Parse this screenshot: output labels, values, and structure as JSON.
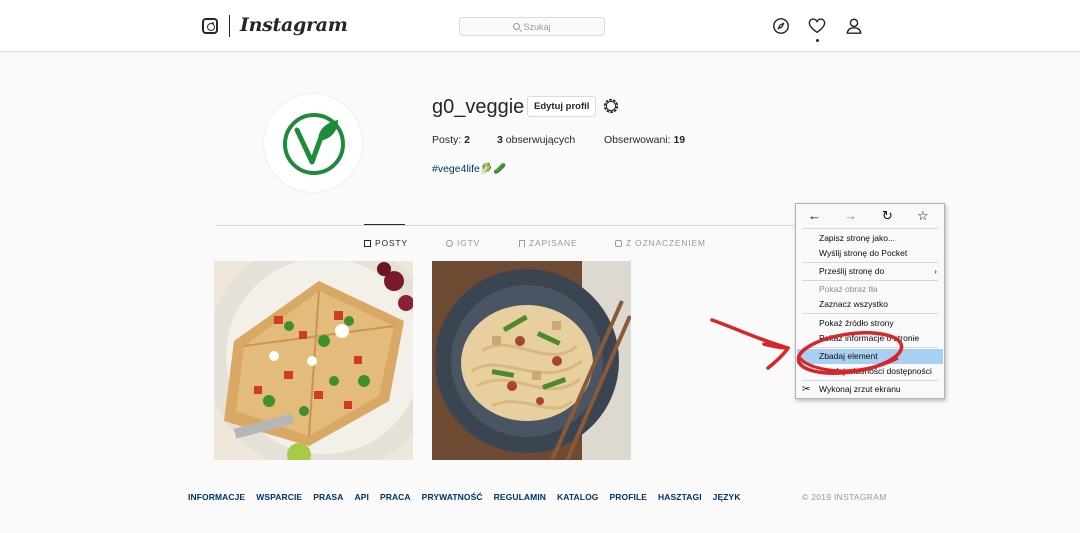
{
  "topbar": {
    "logo_text": "Instagram",
    "search_placeholder": "Szukaj",
    "icons": [
      "compass-icon",
      "heart-icon",
      "user-icon"
    ]
  },
  "profile": {
    "username": "g0_veggie",
    "edit_button": "Edytuj profil",
    "stats": {
      "posts_label": "Posty:",
      "posts_count": "2",
      "followers_count": "3",
      "followers_label": "obserwujących",
      "following_label": "Obserwowani:",
      "following_count": "19"
    },
    "bio": "#vege4life🥬🥒"
  },
  "tabs": [
    {
      "label": "POSTY",
      "icon": "grid-icon",
      "active": true
    },
    {
      "label": "IGTV",
      "icon": "igtv-icon",
      "active": false
    },
    {
      "label": "ZAPISANE",
      "icon": "bookmark-icon",
      "active": false
    },
    {
      "label": "Z OZNACZENIEM",
      "icon": "tag-icon",
      "active": false
    }
  ],
  "footer": {
    "links": [
      "INFORMACJE",
      "WSPARCIE",
      "PRASA",
      "API",
      "PRACA",
      "PRYWATNOŚĆ",
      "REGULAMIN",
      "KATALOG",
      "PROFILE",
      "HASZTAGI",
      "JĘZYK"
    ],
    "copyright": "© 2019 INSTAGRAM"
  },
  "context_menu": {
    "nav_icons": [
      "back-arrow-icon",
      "forward-arrow-icon",
      "reload-icon",
      "bookmark-star-icon"
    ],
    "items": [
      {
        "label": "Zapisz stronę jako...",
        "disabled": false
      },
      {
        "label": "Wyślij stronę do Pocket",
        "disabled": false
      },
      {
        "label": "Prześlij stronę do",
        "disabled": false,
        "submenu": true
      },
      {
        "label": "Pokaż obraz tła",
        "disabled": true
      },
      {
        "label": "Zaznacz wszystko",
        "disabled": false
      },
      {
        "label": "Pokaż źródło strony",
        "disabled": false
      },
      {
        "label": "Pokaż informacje o stronie",
        "disabled": false
      },
      {
        "label": "Zbadaj element",
        "disabled": false,
        "highlighted": true
      },
      {
        "label": "Zbadaj własności dostępności",
        "disabled": false
      },
      {
        "label": "Wykonaj zrzut ekranu",
        "disabled": false
      }
    ]
  },
  "colors": {
    "accent_link": "#003569",
    "menu_highlight": "#a8d0f3",
    "annotation": "#d7262b",
    "vegan_logo_green": "#1e8a3c"
  }
}
